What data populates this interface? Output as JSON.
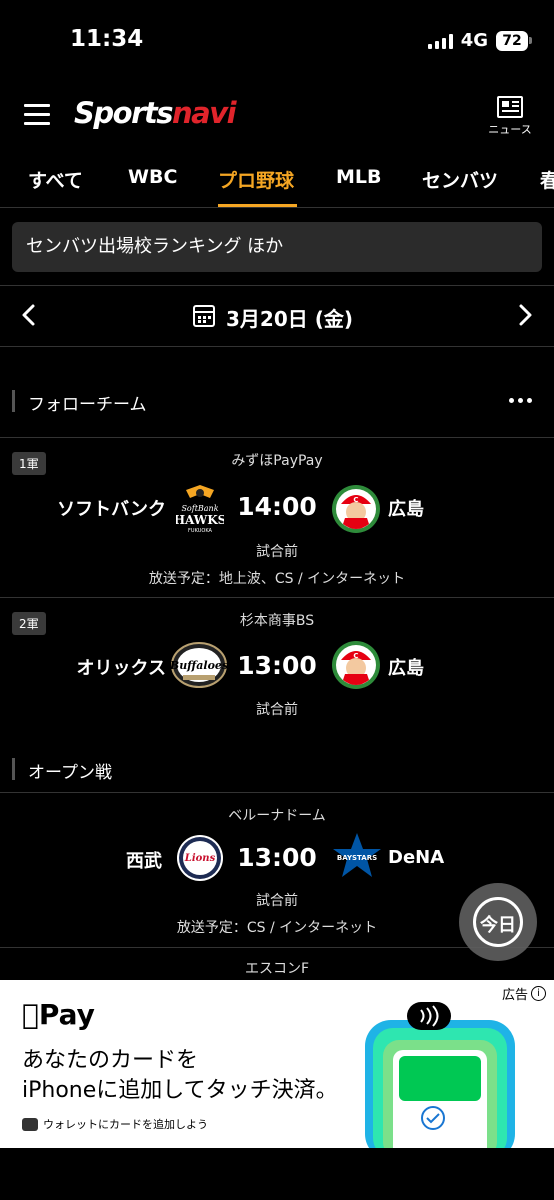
{
  "status_bar": {
    "time": "11:34",
    "network": "4G",
    "battery": "72"
  },
  "header": {
    "brand_part1": "Sports",
    "brand_part2": "navi",
    "news_label": "ニュース"
  },
  "tabs": [
    {
      "label": "すべて"
    },
    {
      "label": "WBC"
    },
    {
      "label": "プロ野球",
      "active": true
    },
    {
      "label": "MLB"
    },
    {
      "label": "センバツ"
    },
    {
      "label": "春"
    }
  ],
  "banner": {
    "text": "センバツ出場校ランキング ほか"
  },
  "date_nav": {
    "date": "3月20日 (金)"
  },
  "sections": [
    {
      "title": "フォローチーム",
      "games": [
        {
          "badge": "1軍",
          "venue": "みずほPayPay",
          "home": "ソフトバンク",
          "away": "広島",
          "time": "14:00",
          "status": "試合前",
          "broadcast": "放送予定：地上波、CS / インターネット",
          "home_logo": "hawks-logo",
          "away_logo": "carp-logo"
        },
        {
          "badge": "2軍",
          "venue": "杉本商事BS",
          "home": "オリックス",
          "away": "広島",
          "time": "13:00",
          "status": "試合前",
          "broadcast": "",
          "home_logo": "buffaloes-logo",
          "away_logo": "carp-logo"
        }
      ]
    },
    {
      "title": "オープン戦",
      "games": [
        {
          "badge": "",
          "venue": "ベルーナドーム",
          "home": "西武",
          "away": "DeNA",
          "time": "13:00",
          "status": "試合前",
          "broadcast": "放送予定：CS / インターネット",
          "home_logo": "lions-logo",
          "away_logo": "baystars-logo"
        },
        {
          "badge": "",
          "venue": "エスコンF",
          "home": "",
          "away": "",
          "time": "",
          "status": "",
          "broadcast": ""
        }
      ]
    }
  ],
  "hawks_logo_text": {
    "line1": "SoftBank",
    "line2": "HAWKS",
    "line3": "FUKUOKA"
  },
  "buffaloes_logo_text": "Buffaloes",
  "lions_logo_text": "Lions",
  "baystars_logo_text": "BAYSTARS",
  "today_button": {
    "label": "今日"
  },
  "ad": {
    "label": "広告",
    "brand": "Pay",
    "line1": "あなたのカードを",
    "line2": "iPhoneに追加してタッチ決済。",
    "wallet_text": "ウォレットにカードを追加しよう"
  },
  "colors": {
    "accent": "#f5a623",
    "brand_red": "#e0242b",
    "carp_red": "#e60012",
    "lions_navy": "#1d2b53",
    "baystars_blue": "#0055a5"
  }
}
